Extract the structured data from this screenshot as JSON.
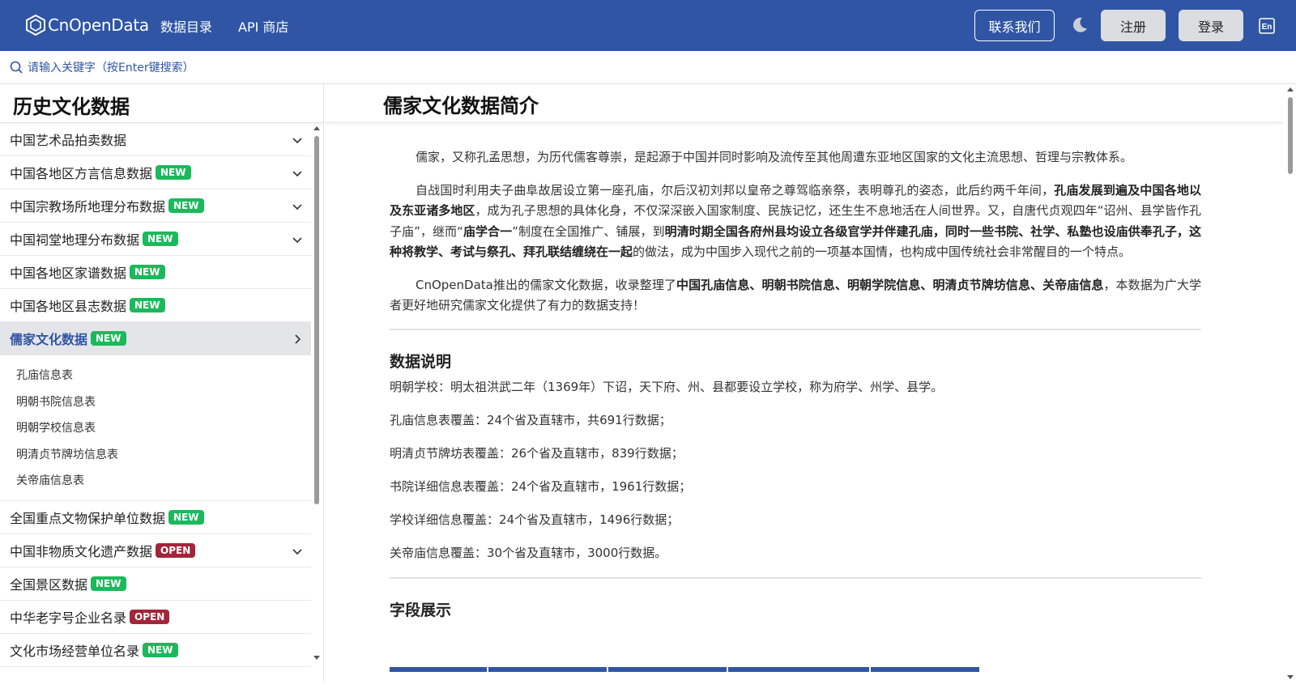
{
  "header": {
    "logo_text": "CnOpenData",
    "nav": [
      "数据目录",
      "API 商店"
    ],
    "contact_label": "联系我们",
    "register_label": "注册",
    "login_label": "登录",
    "lang_label": "En",
    "brand_color": "#2f55a4"
  },
  "search": {
    "placeholder": "请输入关键字（按Enter键搜索）"
  },
  "sidebar": {
    "title": "历史文化数据",
    "items": [
      {
        "label": "中国艺术品拍卖数据",
        "badge": "",
        "expandable": true
      },
      {
        "label": "中国各地区方言信息数据",
        "badge": "NEW",
        "expandable": true
      },
      {
        "label": "中国宗教场所地理分布数据",
        "badge": "NEW",
        "expandable": true
      },
      {
        "label": "中国祠堂地理分布数据",
        "badge": "NEW",
        "expandable": true
      },
      {
        "label": "中国各地区家谱数据",
        "badge": "NEW",
        "expandable": false
      },
      {
        "label": "中国各地区县志数据",
        "badge": "NEW",
        "expandable": false
      },
      {
        "label": "儒家文化数据",
        "badge": "NEW",
        "expandable": true,
        "active": true
      },
      {
        "label": "全国重点文物保护单位数据",
        "badge": "NEW",
        "expandable": false
      },
      {
        "label": "中国非物质文化遗产数据",
        "badge": "OPEN",
        "expandable": true
      },
      {
        "label": "全国景区数据",
        "badge": "NEW",
        "expandable": false
      },
      {
        "label": "中华老字号企业名录",
        "badge": "OPEN",
        "expandable": false
      },
      {
        "label": "文化市场经营单位名录",
        "badge": "NEW",
        "expandable": false
      }
    ],
    "subitems": [
      "孔庙信息表",
      "明朝书院信息表",
      "明朝学校信息表",
      "明清贞节牌坊信息表",
      "关帝庙信息表"
    ],
    "badge_colors": {
      "NEW": "#1cb95c",
      "OPEN": "#a3253a"
    }
  },
  "main": {
    "title": "儒家文化数据简介",
    "intro_p1": "儒家，又称孔孟思想，为历代儒客尊崇，是起源于中国并同时影响及流传至其他周遭东亚地区国家的文化主流思想、哲理与宗教体系。",
    "intro_p2": [
      {
        "t": "自战国时利用夫子曲阜故居设立第一座孔庙，尔后汉初刘邦以皇帝之尊驾临亲祭，表明尊孔的姿态，此后约两千年间，",
        "b": false
      },
      {
        "t": "孔庙发展到遍及中国各地以及东亚诸多地区",
        "b": true
      },
      {
        "t": "，成为孔子思想的具体化身，不仅深深嵌入国家制度、民族记忆，还生生不息地活在人间世界。又，自唐代贞观四年“诏州、县学皆作孔子庙”，继而“",
        "b": false
      },
      {
        "t": "庙学合一",
        "b": true
      },
      {
        "t": "”制度在全国推广、铺展，到",
        "b": false
      },
      {
        "t": "明清时期全国各府州县均设立各级官学并伴建孔庙，同时一些书院、社学、私塾也设庙供奉孔子，这种将教学、考试与祭孔、拜孔联结缠绕在一起",
        "b": true
      },
      {
        "t": "的做法，成为中国步入现代之前的一项基本国情，也构成中国传统社会非常醒目的一个特点。",
        "b": false
      }
    ],
    "intro_p3": [
      {
        "t": "CnOpenData推出的儒家文化数据，收录整理了",
        "b": false
      },
      {
        "t": "中国孔庙信息、明朝书院信息、明朝学院信息、明清贞节牌坊信息、关帝庙信息",
        "b": true
      },
      {
        "t": "，本数据为广大学者更好地研究儒家文化提供了有力的数据支持！",
        "b": false
      }
    ],
    "data_section_title": "数据说明",
    "data_lines": [
      "明朝学校：明太祖洪武二年（1369年）下诏，天下府、州、县都要设立学校，称为府学、州学、县学。",
      "孔庙信息表覆盖：24个省及直辖市，共691行数据；",
      "明清贞节牌坊表覆盖：26个省及直辖市，839行数据；",
      "书院详细信息表覆盖：24个省及直辖市，1961行数据；",
      "学校详细信息覆盖：24个省及直辖市，1496行数据；",
      "关帝庙信息覆盖：30个省及直辖市，3000行数据。"
    ],
    "fields_section_title": "字段展示"
  }
}
